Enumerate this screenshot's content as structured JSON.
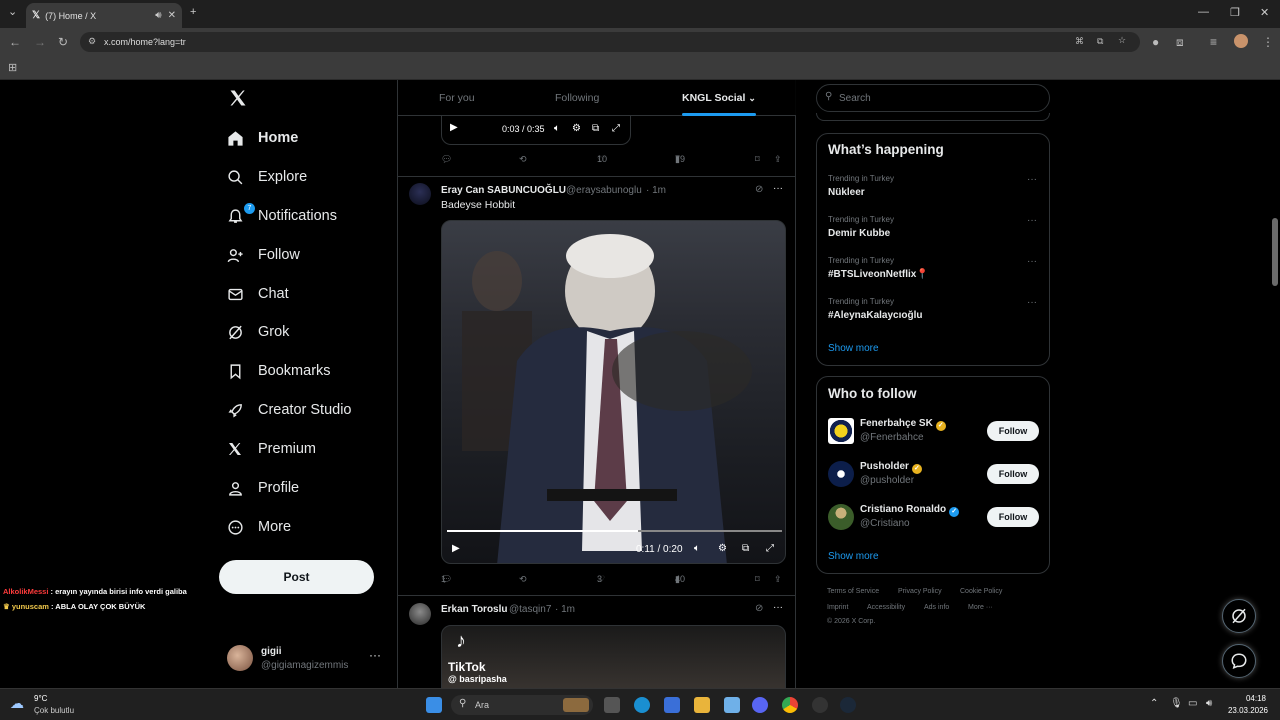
{
  "browser": {
    "tab_title": "(7) Home / X",
    "url": "x.com/home?lang=tr"
  },
  "nav": {
    "items": [
      {
        "label": "Home",
        "icon": "home-icon"
      },
      {
        "label": "Explore",
        "icon": "search-icon"
      },
      {
        "label": "Notifications",
        "icon": "bell-icon",
        "badge": "7"
      },
      {
        "label": "Follow",
        "icon": "add-user-icon"
      },
      {
        "label": "Chat",
        "icon": "mail-icon"
      },
      {
        "label": "Grok",
        "icon": "grok-icon"
      },
      {
        "label": "Bookmarks",
        "icon": "bookmark-icon"
      },
      {
        "label": "Creator Studio",
        "icon": "rocket-icon"
      },
      {
        "label": "Premium",
        "icon": "x-logo-icon"
      },
      {
        "label": "Profile",
        "icon": "person-icon"
      },
      {
        "label": "More",
        "icon": "more-circle-icon"
      }
    ],
    "post_label": "Post",
    "account": {
      "name": "gigii",
      "handle": "@gigiamagizemmis"
    }
  },
  "chat_overlay": [
    {
      "user": "AlkolikMessi",
      "text": " : erayın yayında birisi info verdi galiba",
      "color": "#ff3b3b"
    },
    {
      "user": "yunuscam",
      "text": " : ABLA OLAY ÇOK BÜYÜK",
      "color": "#f2c94c"
    }
  ],
  "feed": {
    "tabs": [
      "For you",
      "Following",
      "KNGL Social"
    ],
    "prev_tweet": {
      "video_time": "0:03 / 0:35",
      "likes": "10",
      "views": "79"
    },
    "tweet1": {
      "name": "Eray Can SABUNCUOĞLU",
      "handle": "@eraysabunoglu",
      "time": "· 1m",
      "text": "Badeyse Hobbit",
      "video_time": "0:11 / 0:20",
      "replies": "1",
      "likes": "3",
      "views": "40"
    },
    "tweet2": {
      "name": "Erkan Toroslu",
      "handle": "@tasqin7",
      "time": "· 1m",
      "tiktok_label": "TikTok",
      "tiktok_user": "@ basripasha"
    }
  },
  "right": {
    "search_placeholder": "Search",
    "happening_title": "What’s happening",
    "trends": [
      {
        "context": "Trending in Turkey",
        "name": "Nükleer"
      },
      {
        "context": "Trending in Turkey",
        "name": "Demir Kubbe"
      },
      {
        "context": "Trending in Turkey",
        "name": "#BTSLiveonNetflix📍"
      },
      {
        "context": "Trending in Turkey",
        "name": "#AleynaKalaycıoğlu"
      }
    ],
    "show_more": "Show more",
    "wtf_title": "Who to follow",
    "who_to_follow": [
      {
        "name": "Fenerbahçe SK",
        "handle": "@Fenerbahce",
        "badge_color": "#e8b21f"
      },
      {
        "name": "Pusholder",
        "handle": "@pusholder",
        "badge_color": "#e8b21f"
      },
      {
        "name": "Cristiano Ronaldo",
        "handle": "@Cristiano",
        "badge_color": "#1d9bf0"
      }
    ],
    "follow_label": "Follow",
    "footer": [
      "Terms of Service",
      "Privacy Policy",
      "Cookie Policy",
      "Imprint",
      "Accessibility",
      "Ads info",
      "More ···",
      "© 2026 X Corp."
    ]
  },
  "taskbar": {
    "weather_temp": "9°C",
    "weather_desc": "Çok bulutlu",
    "search_placeholder": "Ara",
    "time": "04:18",
    "date": "23.03.2026"
  }
}
